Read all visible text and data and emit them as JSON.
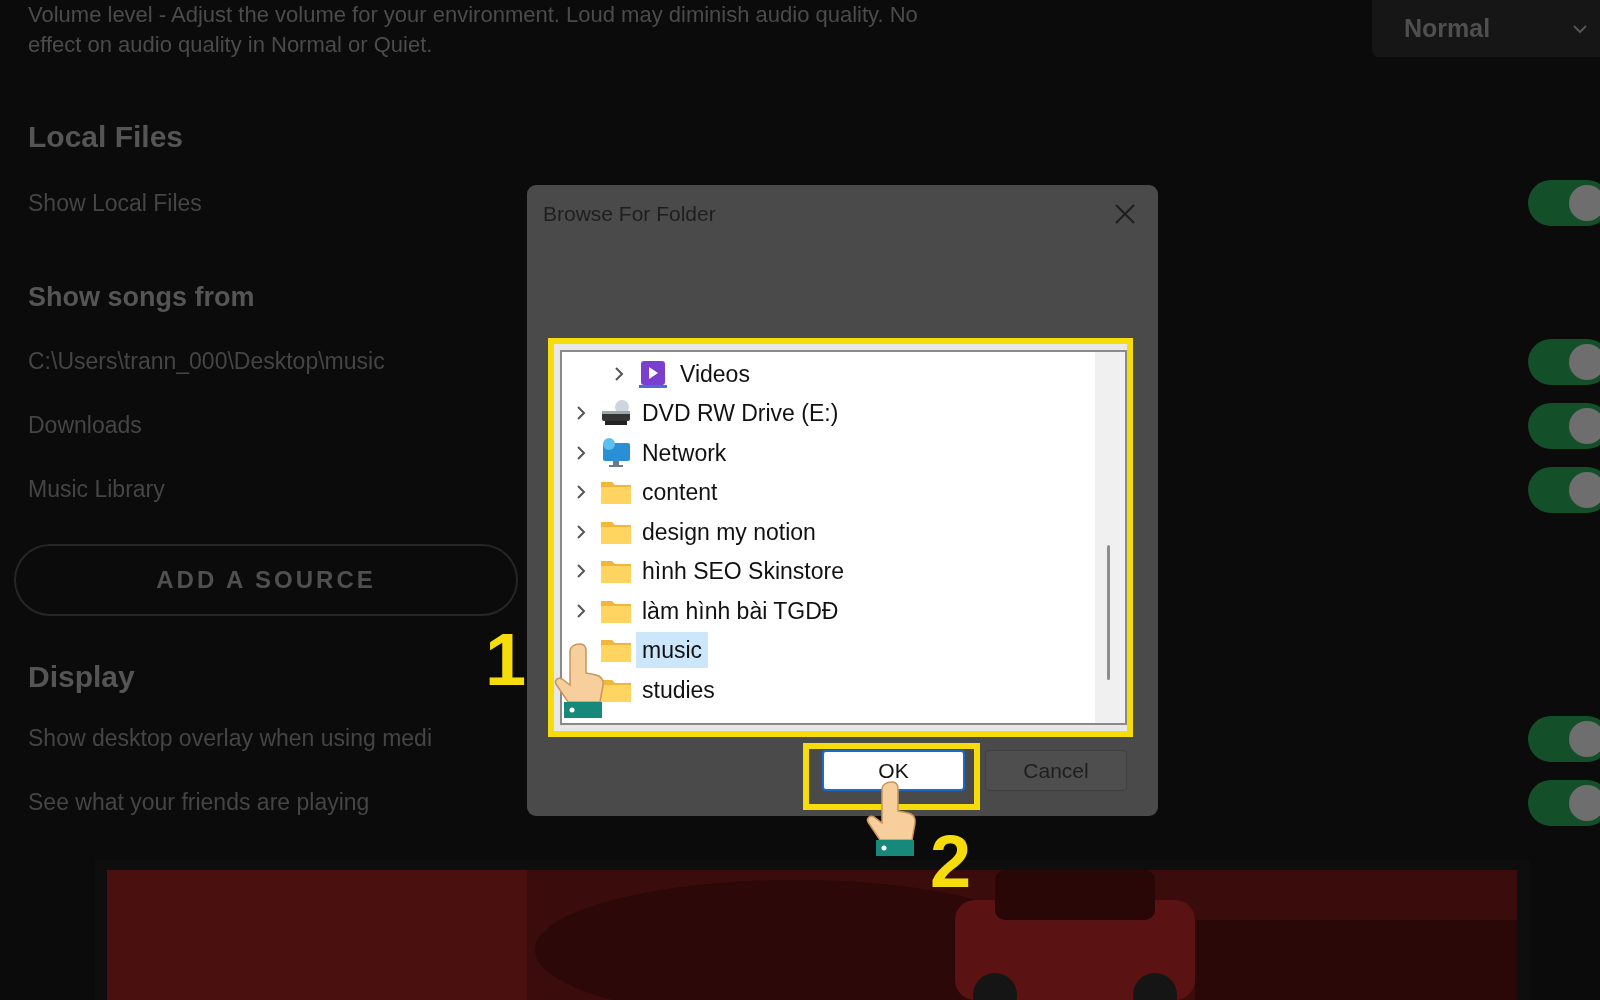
{
  "settings": {
    "volume_note": "Volume level - Adjust the volume for your environment. Loud may diminish audio quality. No effect on audio quality in Normal or Quiet.",
    "quality_select": {
      "value": "Normal"
    },
    "sections": [
      {
        "heading": "Local Files",
        "rows": [
          {
            "label": "Show Local Files",
            "on": true
          }
        ]
      },
      {
        "heading": "Show songs from",
        "rows": [
          {
            "label": "C:\\Users\\trann_000\\Desktop\\music",
            "on": true
          },
          {
            "label": "Downloads",
            "on": true
          },
          {
            "label": "Music Library",
            "on": true
          }
        ],
        "button": "ADD A SOURCE"
      },
      {
        "heading": "Display",
        "rows": [
          {
            "label": "Show desktop overlay when using medi",
            "on": true
          },
          {
            "label": "See what your friends are playing",
            "on": true
          }
        ]
      }
    ]
  },
  "dialog": {
    "title": "Browse For Folder",
    "tree": {
      "partial_branch": [
        {
          "label": "Videos",
          "kind": "video",
          "expander": true,
          "selected": false
        }
      ],
      "items": [
        {
          "label": "DVD RW Drive (E:)",
          "kind": "drive",
          "expander": true,
          "selected": false
        },
        {
          "label": "Network",
          "kind": "network",
          "expander": true,
          "selected": false
        },
        {
          "label": "content",
          "kind": "folder",
          "expander": true,
          "selected": false
        },
        {
          "label": "design my notion",
          "kind": "folder",
          "expander": true,
          "selected": false
        },
        {
          "label": "hình SEO Skinstore",
          "kind": "folder",
          "expander": true,
          "selected": false
        },
        {
          "label": "làm hình bài TGDĐ",
          "kind": "folder",
          "expander": true,
          "selected": false
        },
        {
          "label": "music",
          "kind": "folder",
          "expander": false,
          "selected": true
        },
        {
          "label": "studies",
          "kind": "folder",
          "expander": false,
          "selected": false
        }
      ]
    },
    "buttons": [
      {
        "label": "OK",
        "default": true
      },
      {
        "label": "Cancel",
        "default": false
      }
    ]
  },
  "steps": [
    {
      "number": "1"
    },
    {
      "number": "2"
    }
  ]
}
